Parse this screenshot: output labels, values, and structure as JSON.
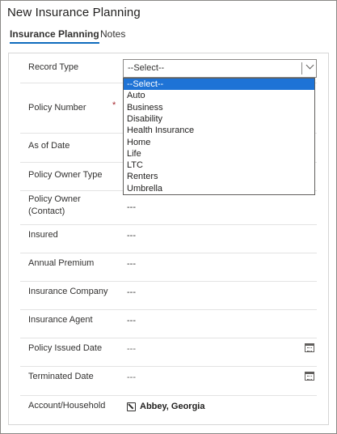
{
  "window": {
    "title": "New Insurance Planning"
  },
  "tabs": [
    {
      "label": "Insurance Planning",
      "active": true
    },
    {
      "label": "Notes",
      "active": false
    }
  ],
  "form": {
    "record_type": {
      "label": "Record Type",
      "selected": "--Select--"
    },
    "policy_number": {
      "label": "Policy Number",
      "required_mark": "*"
    },
    "as_of_date": {
      "label": "As of Date"
    },
    "policy_owner_type": {
      "label": "Policy Owner Type"
    },
    "policy_owner_contact": {
      "label": "Policy Owner (Contact)",
      "value": "---"
    },
    "insured": {
      "label": "Insured",
      "value": "---"
    },
    "annual_premium": {
      "label": "Annual Premium",
      "value": "---"
    },
    "insurance_company": {
      "label": "Insurance Company",
      "value": "---"
    },
    "insurance_agent": {
      "label": "Insurance Agent",
      "value": "---"
    },
    "policy_issued_date": {
      "label": "Policy Issued Date",
      "value": "---",
      "icon": "calendar-icon"
    },
    "terminated_date": {
      "label": "Terminated Date",
      "value": "---",
      "icon": "calendar-icon"
    },
    "account_household": {
      "label": "Account/Household",
      "value": "Abbey, Georgia",
      "icon": "account-link-icon"
    }
  },
  "dropdown": {
    "options": [
      "--Select--",
      "Auto",
      "Business",
      "Disability",
      "Health Insurance",
      "Home",
      "Life",
      "LTC",
      "Renters",
      "Umbrella"
    ],
    "highlighted_index": 0,
    "highlight_color": "#1e73d6"
  },
  "colors": {
    "tab_underline": "#0f6cbd",
    "required": "#a4262c"
  }
}
